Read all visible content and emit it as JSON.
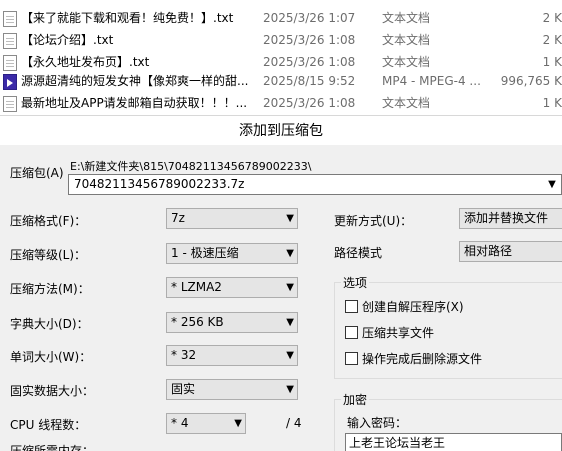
{
  "files": [
    {
      "name": "【来了就能下载和观看！纯免费！】.txt",
      "date": "2025/3/26 1:07",
      "type": "文本文档",
      "size": "2 K",
      "icon": "text-file-icon"
    },
    {
      "name": "【论坛介绍】.txt",
      "date": "2025/3/26 1:08",
      "type": "文本文档",
      "size": "2 K",
      "icon": "text-file-icon"
    },
    {
      "name": "【永久地址发布页】.txt",
      "date": "2025/3/26 1:08",
      "type": "文本文档",
      "size": "1 K",
      "icon": "text-file-icon"
    },
    {
      "name": "源源超清纯的短发女神【像郑爽一样的甜...",
      "date": "2025/8/15 9:52",
      "type": "MP4 - MPEG-4 ...",
      "size": "996,765 K",
      "icon": "video-file-icon"
    },
    {
      "name": "最新地址及APP请发邮箱自动获取！！！...",
      "date": "2025/3/26 1:08",
      "type": "文本文档",
      "size": "1 K",
      "icon": "text-file-icon"
    }
  ],
  "dialog": {
    "title": "添加到压缩包",
    "archive_label": "压缩包(A)",
    "archive_path": "E:\\新建文件夹\\815\\70482113456789002233\\",
    "archive_name": "70482113456789002233.7z",
    "format_label": "压缩格式(F)：",
    "format_value": "7z",
    "level_label": "压缩等级(L)：",
    "level_value": "1 - 极速压缩",
    "method_label": "压缩方法(M)：",
    "method_value": "* LZMA2",
    "dict_label": "字典大小(D)：",
    "dict_value": "* 256 KB",
    "word_label": "单词大小(W)：",
    "word_value": "* 32",
    "solid_label": "固实数据大小：",
    "solid_value": "固实",
    "cpu_label": "CPU 线程数：",
    "cpu_value": "* 4",
    "cpu_total": "/ 4",
    "memory_label": "压缩所需内存：",
    "update_label": "更新方式(U)：",
    "update_value": "添加并替换文件",
    "pathmode_label": "路径模式",
    "pathmode_value": "相对路径",
    "options_title": "选项",
    "opt_sfx": "创建自解压程序(X)",
    "opt_shared": "压缩共享文件",
    "opt_delete": "操作完成后删除源文件",
    "encrypt_title": "加密",
    "password_label": "输入密码：",
    "password_value": "上老王论坛当老王"
  }
}
